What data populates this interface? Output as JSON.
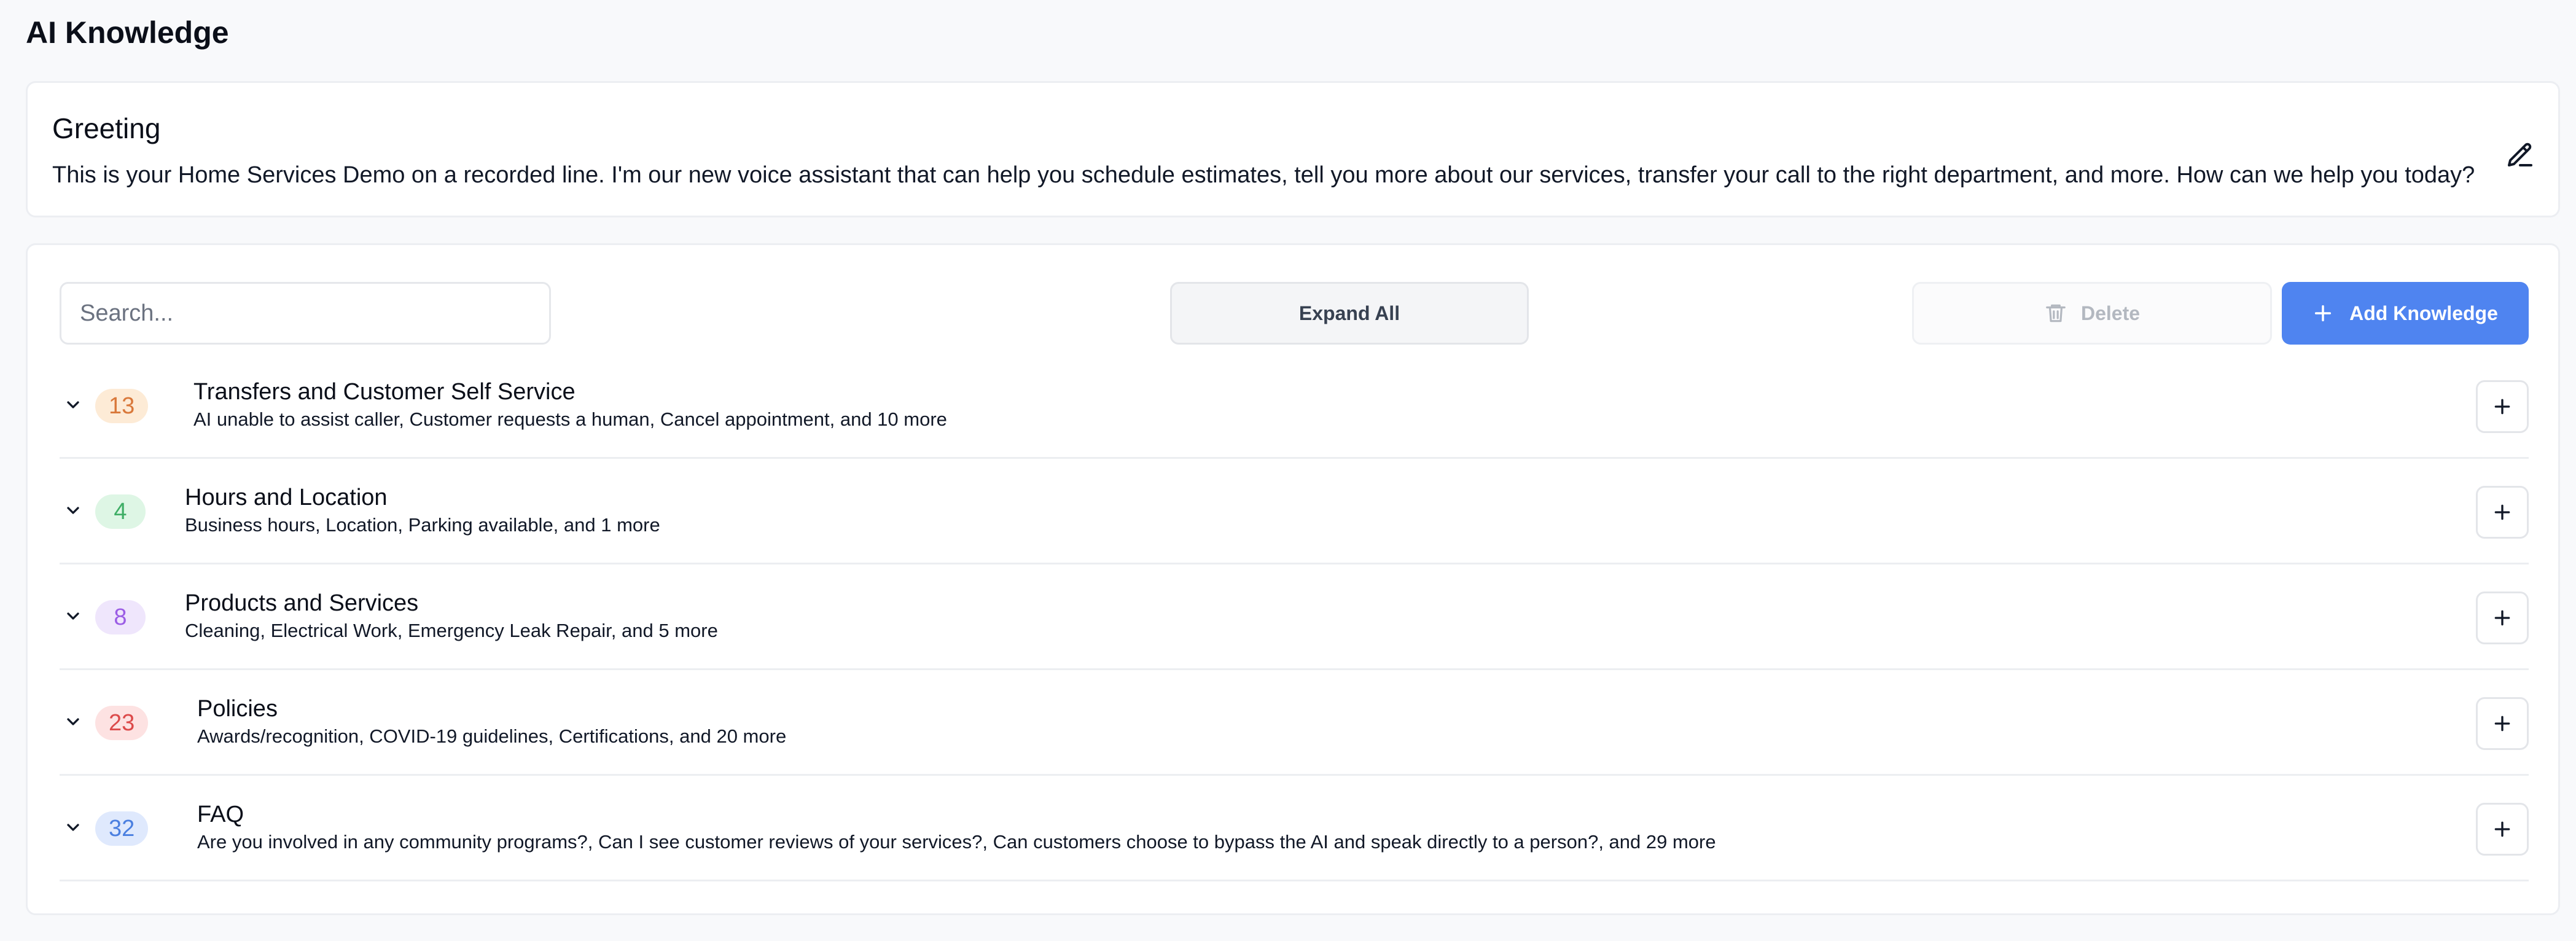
{
  "page_title": "AI Knowledge",
  "greeting": {
    "title": "Greeting",
    "text": "This is your Home Services Demo on a recorded line. I'm our new voice assistant that can help you schedule estimates, tell you more about our services, transfer your call to the right department, and more. How can we help you today?",
    "edit_icon": "pencil-icon"
  },
  "toolbar": {
    "search_placeholder": "Search...",
    "expand_label": "Expand All",
    "delete_label": "Delete",
    "delete_icon": "trash-icon",
    "add_label": "Add Knowledge",
    "add_icon": "plus-icon",
    "accent_color": "#4f84f0"
  },
  "categories": [
    {
      "count": "13",
      "title": "Transfers and Customer Self Service",
      "summary": "AI unable to assist caller, Customer requests a human, Cancel appointment, and 10 more",
      "badge_bg": "#fdebd6",
      "badge_fg": "#d9783a"
    },
    {
      "count": "4",
      "title": "Hours and Location",
      "summary": "Business hours, Location, Parking available, and 1 more",
      "badge_bg": "#def6e5",
      "badge_fg": "#3fae66"
    },
    {
      "count": "8",
      "title": "Products and Services",
      "summary": "Cleaning, Electrical Work, Emergency Leak Repair, and 5 more",
      "badge_bg": "#efe6fc",
      "badge_fg": "#9b5de5"
    },
    {
      "count": "23",
      "title": "Policies",
      "summary": "Awards/recognition, COVID-19 guidelines, Certifications, and 20 more",
      "badge_bg": "#fde2e2",
      "badge_fg": "#dc4a4a"
    },
    {
      "count": "32",
      "title": "FAQ",
      "summary": "Are you involved in any community programs?, Can I see customer reviews of your services?, Can customers choose to bypass the AI and speak directly to a person?, and 29 more",
      "badge_bg": "#dfe9fd",
      "badge_fg": "#4a7fe0"
    }
  ]
}
